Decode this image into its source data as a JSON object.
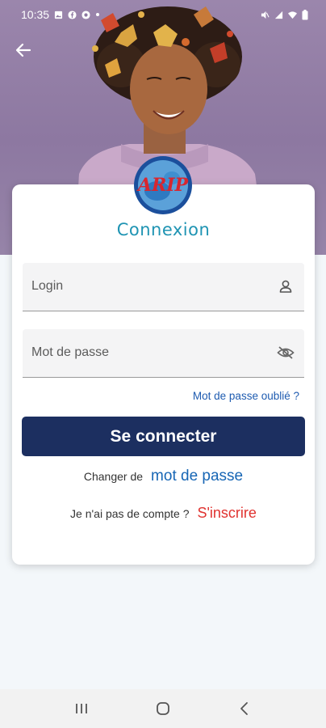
{
  "status_bar": {
    "time": "10:35",
    "left_icons": [
      "image-icon",
      "facebook-icon",
      "app-icon",
      "dot-icon"
    ],
    "right_icons": [
      "mute-icon",
      "signal-icon",
      "wifi-icon",
      "battery-icon"
    ]
  },
  "header": {
    "back_icon": "arrow-left-icon"
  },
  "card": {
    "logo_text": "ARIP",
    "title": "Connexion",
    "login_field": {
      "label": "Login",
      "icon": "person-icon"
    },
    "password_field": {
      "label": "Mot de passe",
      "icon": "eye-off-icon"
    },
    "forgot_link": "Mot de passe oublié ?",
    "submit_label": "Se connecter",
    "change_password": {
      "prefix": "Changer de",
      "link": "mot de passe"
    },
    "register": {
      "prefix": "Je n'ai pas de compte ?",
      "link": "S'inscrire"
    }
  },
  "colors": {
    "primary": "#1c2f60",
    "title": "#1f94b3",
    "link_blue": "#1766b5",
    "link_red": "#e0322f",
    "hero_bg": "#9b86ac"
  },
  "nav_bar": {
    "icons": [
      "recent-apps-icon",
      "home-icon",
      "back-icon"
    ]
  }
}
